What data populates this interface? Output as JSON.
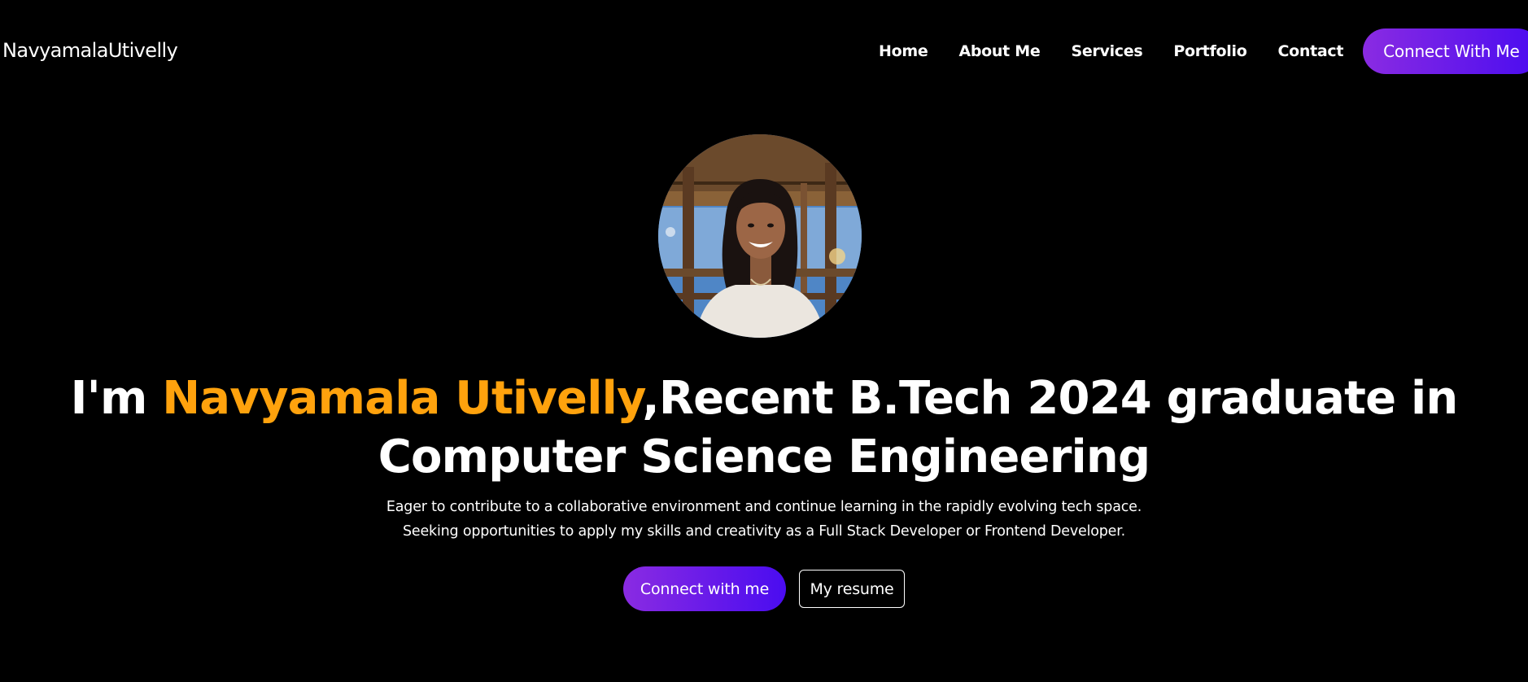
{
  "navbar": {
    "brand": "NavyamalaUtivelly",
    "links": [
      {
        "label": "Home"
      },
      {
        "label": "About Me"
      },
      {
        "label": "Services"
      },
      {
        "label": "Portfolio"
      },
      {
        "label": "Contact"
      }
    ],
    "cta_label": "Connect With Me"
  },
  "hero": {
    "avatar_icon": "profile-photo",
    "title_prefix": "I'm ",
    "title_name": "Navyamala Utivelly",
    "title_rest": ",Recent B.Tech 2024 graduate in Computer Science Engineering",
    "description_lines": [
      "Eager to contribute to a collaborative environment and continue learning in the rapidly evolving tech space.",
      "Seeking opportunities to apply my skills and creativity as a Full Stack Developer or Frontend Developer."
    ],
    "primary_button": "Connect with me",
    "secondary_button": "My resume"
  },
  "colors": {
    "background": "#000000",
    "accent_name": "#ffa20d",
    "gradient_start": "#8a2be2",
    "gradient_end": "#4a0cf0"
  }
}
